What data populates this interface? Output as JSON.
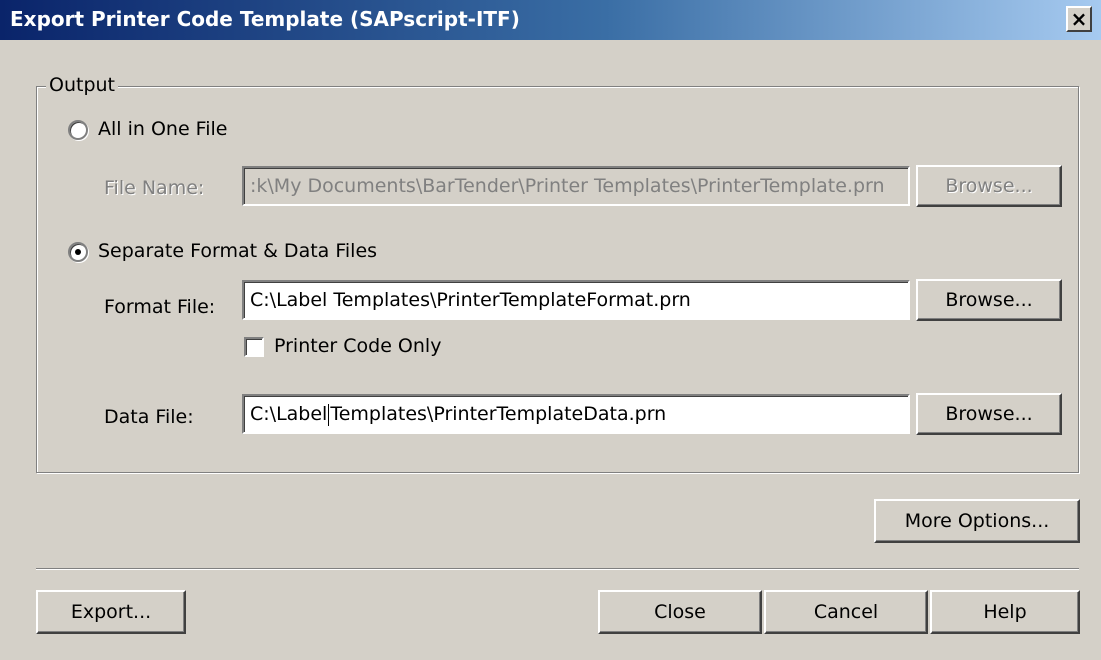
{
  "window": {
    "title": "Export Printer Code Template (SAPscript-ITF)",
    "close_glyph": "×"
  },
  "output_group": {
    "legend": "Output",
    "all_in_one": {
      "label": "All in One File",
      "selected": false,
      "file_name_label": "File Name:",
      "file_name_value": ":k\\My Documents\\BarTender\\Printer Templates\\PrinterTemplate.prn",
      "browse_label": "Browse...",
      "enabled": false
    },
    "separate": {
      "label": "Separate Format & Data Files",
      "selected": true,
      "format_file_label": "Format File:",
      "format_file_value": "C:\\Label Templates\\PrinterTemplateFormat.prn",
      "format_browse_label": "Browse...",
      "printer_code_only_label": "Printer Code Only",
      "printer_code_only_checked": false,
      "data_file_label": "Data File:",
      "data_file_value_before_caret": "C:\\Label",
      "data_file_value_after_caret": "Templates\\PrinterTemplateData.prn",
      "data_browse_label": "Browse..."
    }
  },
  "buttons": {
    "more_options": "More Options...",
    "export": "Export...",
    "close": "Close",
    "cancel": "Cancel",
    "help": "Help"
  }
}
